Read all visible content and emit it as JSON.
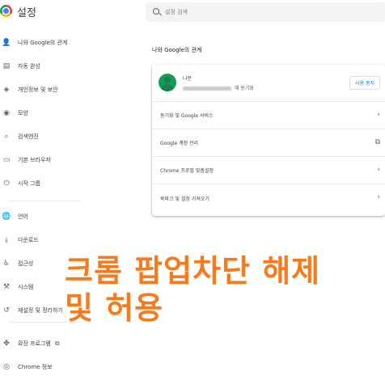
{
  "app": {
    "title": "설정"
  },
  "search": {
    "placeholder": "설정 검색"
  },
  "sidebar": {
    "items": [
      {
        "label": "나와 Google의 관계",
        "icon": "person-icon"
      },
      {
        "label": "자동 완성",
        "icon": "clipboard-icon"
      },
      {
        "label": "개인정보 및 보안",
        "icon": "shield-icon"
      },
      {
        "label": "모양",
        "icon": "palette-icon"
      },
      {
        "label": "검색엔진",
        "icon": "search-icon"
      },
      {
        "label": "기본 브라우저",
        "icon": "browser-icon"
      },
      {
        "label": "시작 그룹",
        "icon": "power-icon"
      },
      {
        "label": "언어",
        "icon": "globe-icon"
      },
      {
        "label": "다운로드",
        "icon": "download-icon"
      },
      {
        "label": "접근성",
        "icon": "accessibility-icon"
      },
      {
        "label": "시스템",
        "icon": "wrench-icon"
      },
      {
        "label": "재설정 및 정리하기",
        "icon": "restore-icon"
      },
      {
        "label": "확장 프로그램",
        "icon": "puzzle-icon"
      },
      {
        "label": "Chrome 정보",
        "icon": "chrome-icon"
      }
    ]
  },
  "main": {
    "section_title": "나와 Google의 관계",
    "profile": {
      "name": "나분",
      "email_suffix": "에 동기화"
    },
    "sync_button": "사용 중지",
    "rows": [
      {
        "label": "동기화 및 Google 서비스",
        "icon": "chevron-right-icon"
      },
      {
        "label": "Google 계정 관리",
        "icon": "external-link-icon"
      },
      {
        "label": "Chrome 프로필 맞춤설정",
        "icon": "chevron-right-icon"
      },
      {
        "label": "북마크 및 설정 가져오기",
        "icon": "chevron-right-icon"
      }
    ]
  },
  "overlay": {
    "line1": "크롬 팝업차단 해제",
    "line2": "및 허용",
    "color": "#f77a1c"
  }
}
